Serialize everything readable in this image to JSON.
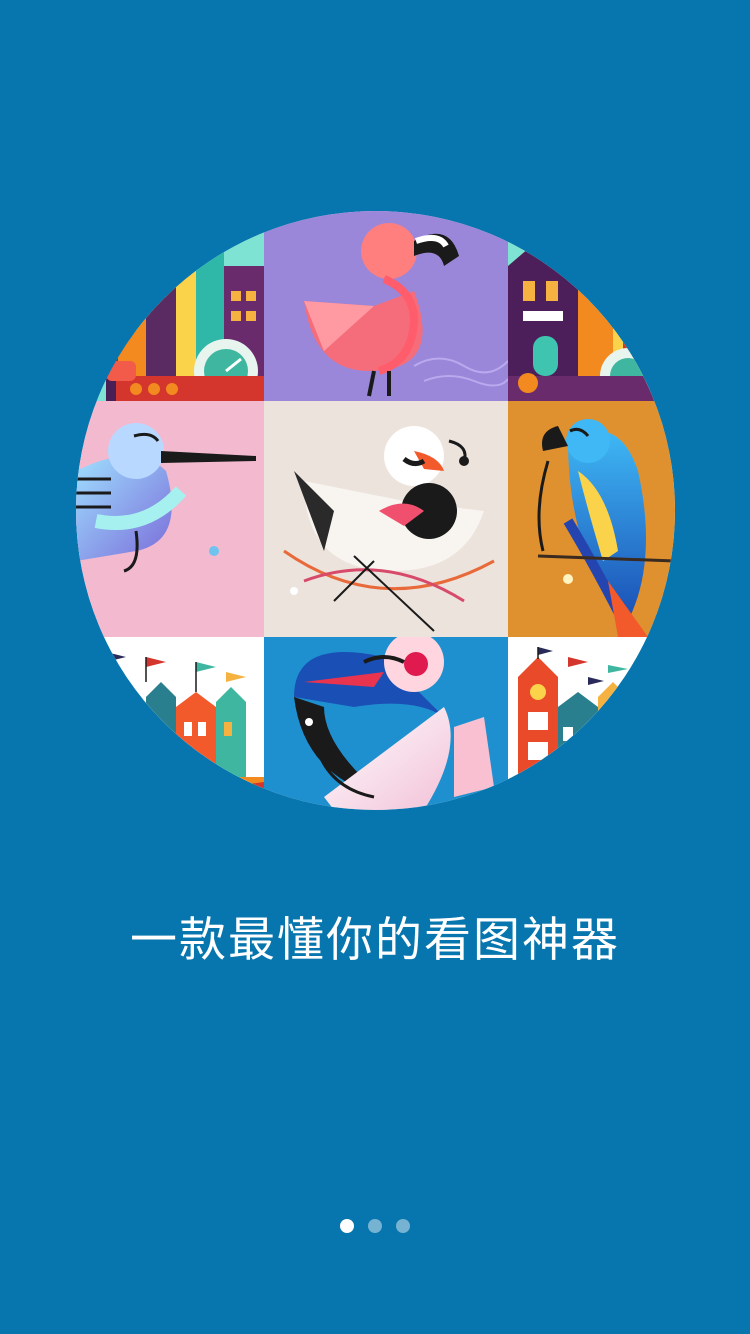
{
  "onboarding": {
    "tagline": "一款最懂你的看图神器",
    "pager": {
      "count": 3,
      "active_index": 0
    }
  },
  "gallery": {
    "tiles": [
      {
        "icon": "city-buildings-illustration-icon",
        "bg": "#7fe3d3"
      },
      {
        "icon": "flamingo-illustration-icon",
        "bg": "#9b87d9"
      },
      {
        "icon": "town-house-illustration-icon",
        "bg": "#7fe3d3"
      },
      {
        "icon": "hummingbird-illustration-icon",
        "bg": "#f2b9cf"
      },
      {
        "icon": "swan-illustration-icon",
        "bg": "#ece3dc"
      },
      {
        "icon": "parrot-illustration-icon",
        "bg": "#e0912f"
      },
      {
        "icon": "castle-flags-illustration-icon",
        "bg": "#ffffff"
      },
      {
        "icon": "pelican-illustration-icon",
        "bg": "#1f90cf"
      },
      {
        "icon": "clock-tower-illustration-icon",
        "bg": "#ffffff"
      }
    ]
  },
  "colors": {
    "background": "#0776ae",
    "dot_active": "#ffffff",
    "dot_inactive": "rgba(255,255,255,0.45)"
  }
}
